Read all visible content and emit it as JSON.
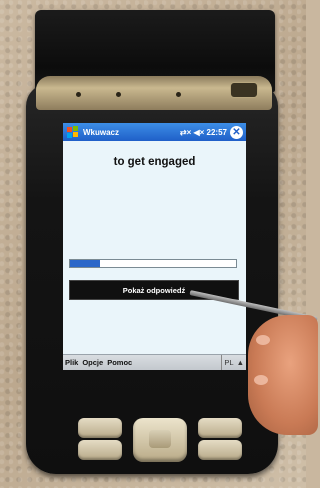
{
  "app": {
    "title": "Wkuwacz",
    "status_icons": "⇄× ◀× 22:57",
    "close_label": "✕"
  },
  "card": {
    "text": "to get engaged",
    "progress": 0.18,
    "answer_button": "Pokaż odpowiedź"
  },
  "menubar": {
    "items": [
      "Plik",
      "Opcje",
      "Pomoc"
    ],
    "input_lang": "PL",
    "input_arrow": "▲"
  },
  "colors": {
    "title_bar": "#1f5fc8",
    "progress_fill": "#2b67c9",
    "button_bg": "#101010"
  }
}
